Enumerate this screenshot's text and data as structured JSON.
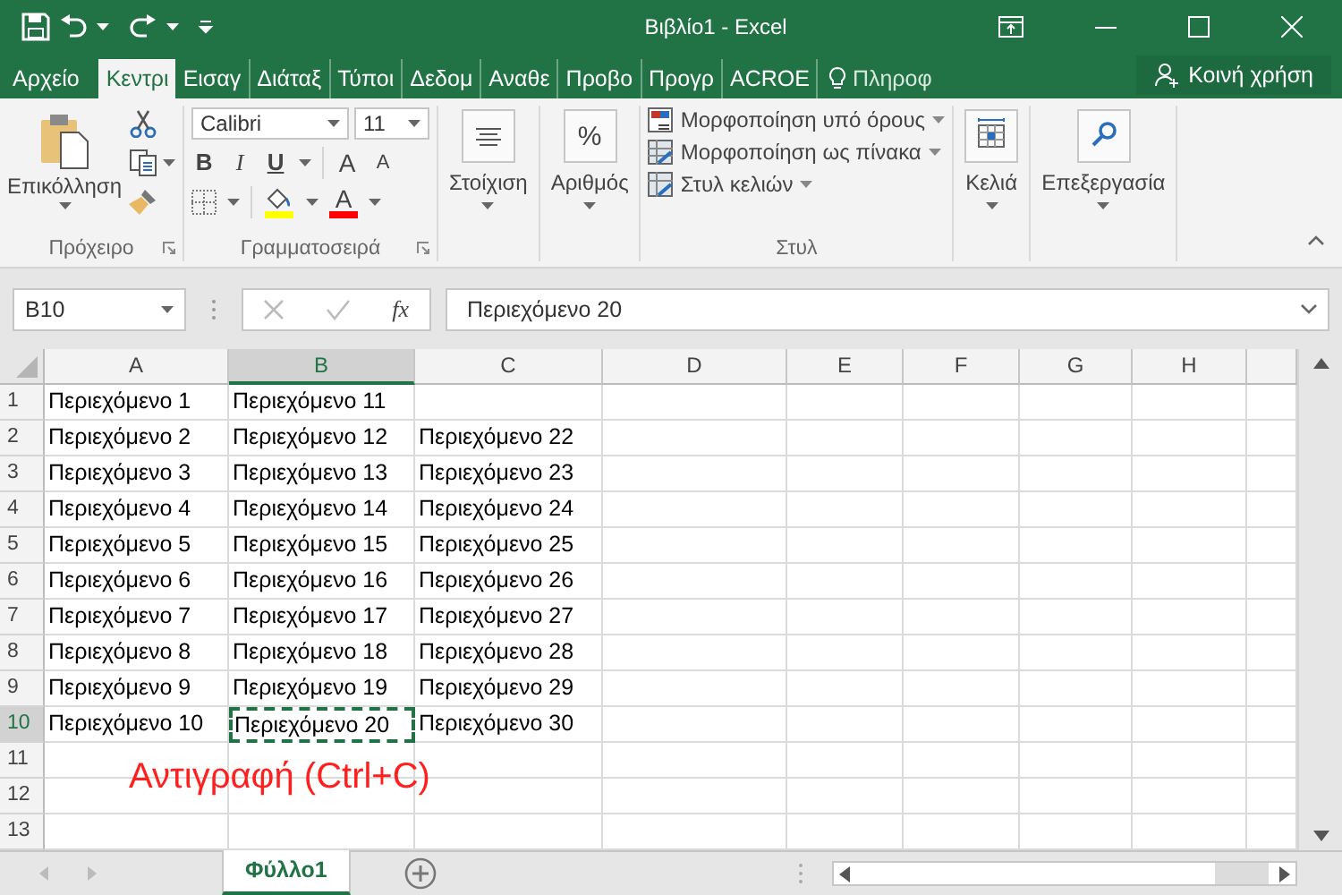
{
  "window": {
    "title": "Βιβλίο1 - Excel"
  },
  "ribbon_tabs": [
    {
      "label": "Αρχείο",
      "selected": false,
      "kind": "file"
    },
    {
      "label": "Κεντρι",
      "selected": true,
      "kind": "tab"
    },
    {
      "label": "Εισαγ",
      "selected": false,
      "kind": "tab"
    },
    {
      "label": "Διάταξ",
      "selected": false,
      "kind": "tab"
    },
    {
      "label": "Τύποι",
      "selected": false,
      "kind": "tab"
    },
    {
      "label": "Δεδομ",
      "selected": false,
      "kind": "tab"
    },
    {
      "label": "Αναθε",
      "selected": false,
      "kind": "tab"
    },
    {
      "label": "Προβο",
      "selected": false,
      "kind": "tab"
    },
    {
      "label": "Προγρ",
      "selected": false,
      "kind": "tab"
    },
    {
      "label": "ACROE",
      "selected": false,
      "kind": "tab"
    }
  ],
  "tell_me": {
    "placeholder": "Πληροφ"
  },
  "share_button": "Κοινή χρήση",
  "ribbon_groups": [
    {
      "kind": "clipboard",
      "label": "Πρόχειρο",
      "button": "Επικόλληση"
    },
    {
      "kind": "font",
      "label": "Γραμματοσειρά",
      "font": "Calibri",
      "size": "11",
      "bold": "B",
      "italic": "I",
      "underline": "U",
      "grow": "A",
      "shrink": "A",
      "font_color": "A"
    },
    {
      "kind": "alignment",
      "button": "Στοίχιση"
    },
    {
      "kind": "number",
      "symbol": "%",
      "button": "Αριθμός"
    },
    {
      "kind": "styles",
      "label": "Στυλ",
      "items": [
        "Μορφοποίηση υπό όρους",
        "Μορφοποίηση ως πίνακα",
        "Στυλ κελιών"
      ]
    },
    {
      "kind": "cells",
      "button": "Κελιά"
    },
    {
      "kind": "editing",
      "button": "Επεξεργασία"
    }
  ],
  "name_box": "B10",
  "formula_bar": {
    "function_button": "fx",
    "value": "Περιεχόμενο 20"
  },
  "columns": [
    {
      "label": "A",
      "selected": false
    },
    {
      "label": "B",
      "selected": true
    },
    {
      "label": "C",
      "selected": false
    },
    {
      "label": "D",
      "selected": false
    },
    {
      "label": "E",
      "selected": false
    },
    {
      "label": "F",
      "selected": false
    },
    {
      "label": "G",
      "selected": false
    },
    {
      "label": "H",
      "selected": false
    }
  ],
  "rows": [
    {
      "header": "1",
      "selected": false,
      "cells": [
        {
          "text": "Περιεχόμενο 1",
          "copied": false
        },
        {
          "text": "Περιεχόμενο 11",
          "copied": false
        }
      ]
    },
    {
      "header": "2",
      "selected": false,
      "cells": [
        {
          "text": "Περιεχόμενο 2",
          "copied": false
        },
        {
          "text": "Περιεχόμενο 12",
          "copied": false
        },
        {
          "text": "Περιεχόμενο 22",
          "copied": false
        }
      ]
    },
    {
      "header": "3",
      "selected": false,
      "cells": [
        {
          "text": "Περιεχόμενο 3",
          "copied": false
        },
        {
          "text": "Περιεχόμενο 13",
          "copied": false
        },
        {
          "text": "Περιεχόμενο 23",
          "copied": false
        }
      ]
    },
    {
      "header": "4",
      "selected": false,
      "cells": [
        {
          "text": "Περιεχόμενο 4",
          "copied": false
        },
        {
          "text": "Περιεχόμενο 14",
          "copied": false
        },
        {
          "text": "Περιεχόμενο 24",
          "copied": false
        }
      ]
    },
    {
      "header": "5",
      "selected": false,
      "cells": [
        {
          "text": "Περιεχόμενο 5",
          "copied": false
        },
        {
          "text": "Περιεχόμενο 15",
          "copied": false
        },
        {
          "text": "Περιεχόμενο 25",
          "copied": false
        }
      ]
    },
    {
      "header": "6",
      "selected": false,
      "cells": [
        {
          "text": "Περιεχόμενο 6",
          "copied": false
        },
        {
          "text": "Περιεχόμενο 16",
          "copied": false
        },
        {
          "text": "Περιεχόμενο 26",
          "copied": false
        }
      ]
    },
    {
      "header": "7",
      "selected": false,
      "cells": [
        {
          "text": "Περιεχόμενο 7",
          "copied": false
        },
        {
          "text": "Περιεχόμενο 17",
          "copied": false
        },
        {
          "text": "Περιεχόμενο 27",
          "copied": false
        }
      ]
    },
    {
      "header": "8",
      "selected": false,
      "cells": [
        {
          "text": "Περιεχόμενο 8",
          "copied": false
        },
        {
          "text": "Περιεχόμενο 18",
          "copied": false
        },
        {
          "text": "Περιεχόμενο 28",
          "copied": false
        }
      ]
    },
    {
      "header": "9",
      "selected": false,
      "cells": [
        {
          "text": "Περιεχόμενο 9",
          "copied": false
        },
        {
          "text": "Περιεχόμενο 19",
          "copied": false
        },
        {
          "text": "Περιεχόμενο 29",
          "copied": false
        }
      ]
    },
    {
      "header": "10",
      "selected": true,
      "cells": [
        {
          "text": "Περιεχόμενο 10",
          "copied": false
        },
        {
          "text": "Περιεχόμενο 20",
          "copied": true
        },
        {
          "text": "Περιεχόμενο 30",
          "copied": false
        }
      ]
    },
    {
      "header": "11",
      "selected": false
    },
    {
      "header": "12",
      "selected": false
    },
    {
      "header": "13",
      "selected": false
    }
  ],
  "annotation": "Αντιγραφή (Ctrl+C)",
  "sheet_tabs": [
    {
      "label": "Φύλλο1",
      "selected": true
    }
  ]
}
